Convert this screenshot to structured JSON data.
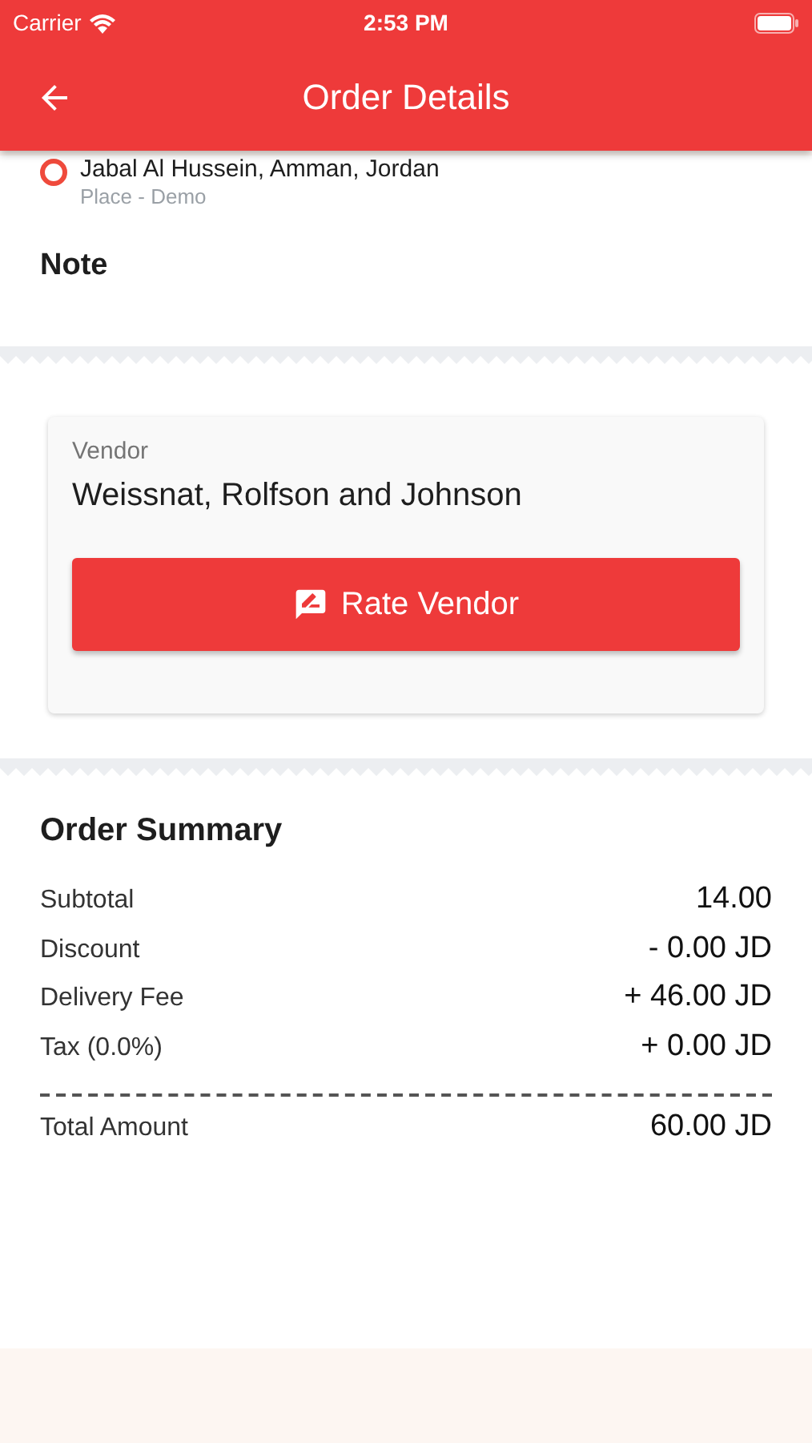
{
  "status_bar": {
    "carrier": "Carrier",
    "time": "2:53 PM"
  },
  "app_bar": {
    "title": "Order Details"
  },
  "address": {
    "line": "Jabal Al Hussein, Amman, Jordan",
    "place": "Place - Demo"
  },
  "note": {
    "title": "Note"
  },
  "vendor": {
    "label": "Vendor",
    "name": "Weissnat, Rolfson and Johnson",
    "button": "Rate Vendor"
  },
  "summary": {
    "title": "Order Summary",
    "rows": [
      {
        "label": "Subtotal",
        "value": "14.00"
      },
      {
        "label": "Discount",
        "value": "- 0.00 JD"
      },
      {
        "label": "Delivery Fee",
        "value": "+ 46.00 JD"
      },
      {
        "label": "Tax (0.0%)",
        "value": "+ 0.00 JD"
      }
    ],
    "total": {
      "label": "Total Amount",
      "value": "60.00 JD"
    }
  }
}
